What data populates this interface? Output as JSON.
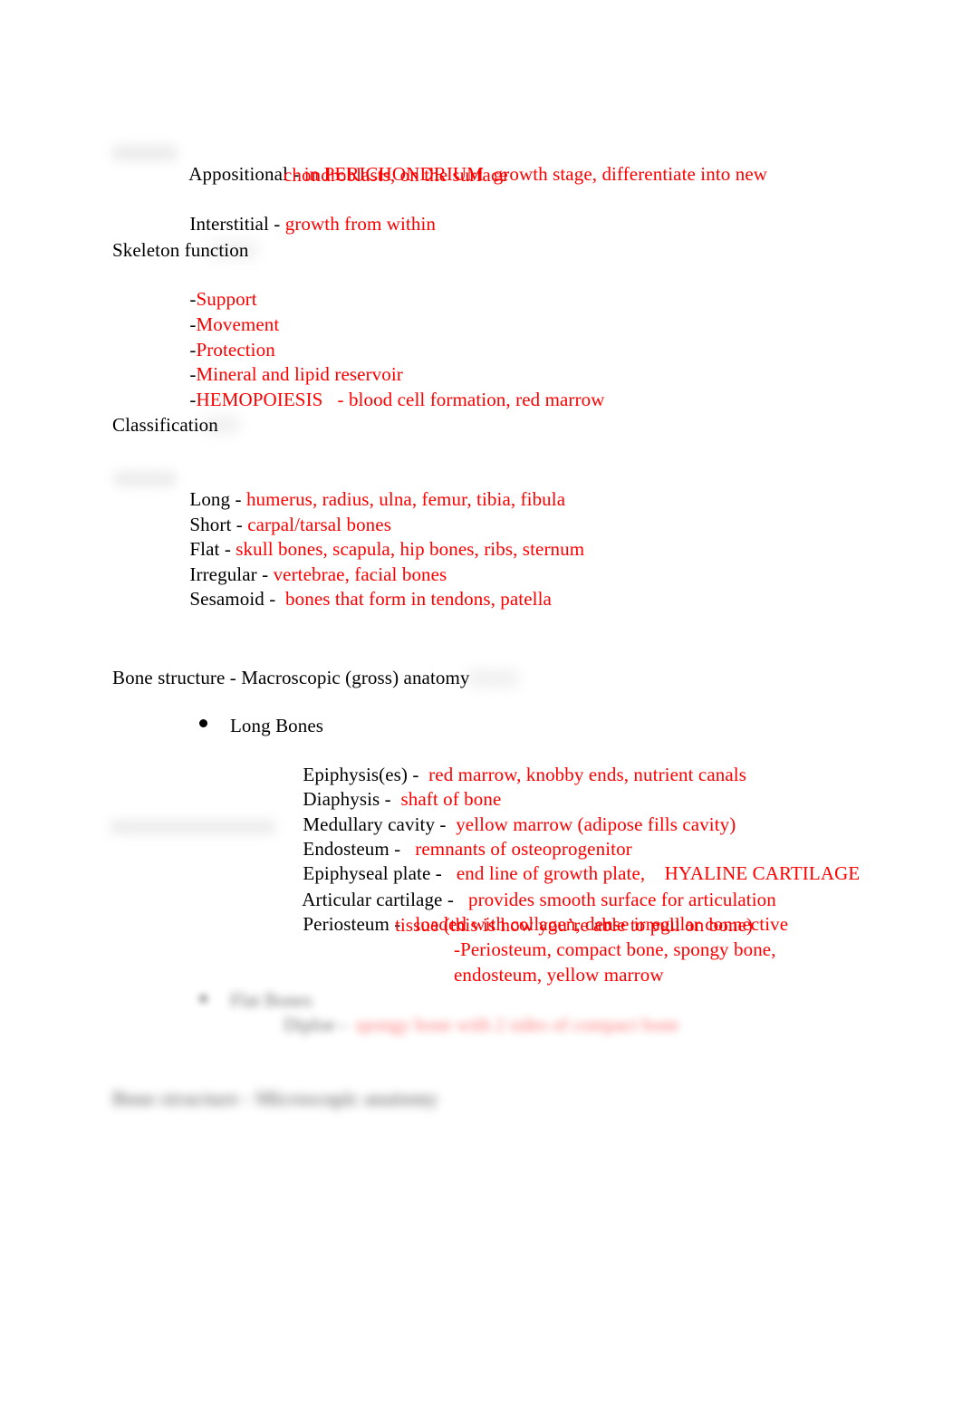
{
  "document": {
    "title_visible": false,
    "text_color_black": "#000000",
    "text_color_red": "#fd0000",
    "background": "#ffffff"
  },
  "cartilage_growth": {
    "appositional": {
      "term": "Appositional - ",
      "definition": "in PERICHONDRIUM  growth stage, differentiate into new",
      "definition_cont": "chondroblasts, on the surface"
    },
    "interstitial": {
      "term": "Interstitial - ",
      "definition": "growth from within"
    }
  },
  "skeleton_function": {
    "heading": "Skeleton function",
    "items": [
      {
        "dash": "-",
        "label": "Support",
        "note": ""
      },
      {
        "dash": "-",
        "label": "Movement",
        "note": ""
      },
      {
        "dash": "-",
        "label": "Protection",
        "note": ""
      },
      {
        "dash": "-",
        "label": "Mineral and lipid reservoir",
        "note": ""
      },
      {
        "dash": "-",
        "label": "HEMOPOIESIS",
        "note": "   - blood cell formation, red marrow"
      }
    ]
  },
  "classification": {
    "heading": "Classification",
    "rows": [
      {
        "term": "Long - ",
        "value": "humerus, radius, ulna, femur, tibia, fibula"
      },
      {
        "term": "Short - ",
        "value": "carpal/tarsal bones"
      },
      {
        "term": "Flat - ",
        "value": "skull bones, scapula, hip bones, ribs, sternum"
      },
      {
        "term": "Irregular - ",
        "value": "vertebrae, facial bones"
      },
      {
        "term": "Sesamoid - ",
        "value": " bones that form in tendons, patella"
      }
    ]
  },
  "bone_structure_macro": {
    "heading": "Bone structure - Macroscopic (gross) anatomy",
    "long_bones": {
      "bullet_label": "Long Bones",
      "rows": [
        {
          "term": "Epiphysis(es) - ",
          "value": " red marrow, knobby ends, nutrient canals"
        },
        {
          "term": "Diaphysis - ",
          "value": " shaft of bone"
        },
        {
          "term": "Medullary cavity - ",
          "value": " yellow marrow (adipose fills cavity)"
        },
        {
          "term": "Endosteum - ",
          "value": "  remnants of osteoprogenitor"
        },
        {
          "term": "Epiphyseal plate - ",
          "value": "  end line of growth plate,    HYALINE CARTILAGE"
        },
        {
          "term": "Articular cartilage - ",
          "value": "  provides smooth surface for articulation"
        },
        {
          "term": "Periosteum - ",
          "value": "  loaded with collagen, dense irregular connective"
        }
      ],
      "periosteum_cont_1": "tissue (this is how you’re able to pull on bone)",
      "periosteum_cont_2": "-Periosteum, compact bone, spongy bone,",
      "periosteum_cont_3": "endosteum, yellow marrow"
    },
    "flat_bones_blurred": {
      "bullet_label": "Flat Bones",
      "term": "Diploe - ",
      "value": "spongy bone with 2 sides of compact bone",
      "legible": false
    }
  },
  "bone_structure_micro": {
    "heading": "Bone structure - Microscopic anatomy",
    "legible": false
  }
}
